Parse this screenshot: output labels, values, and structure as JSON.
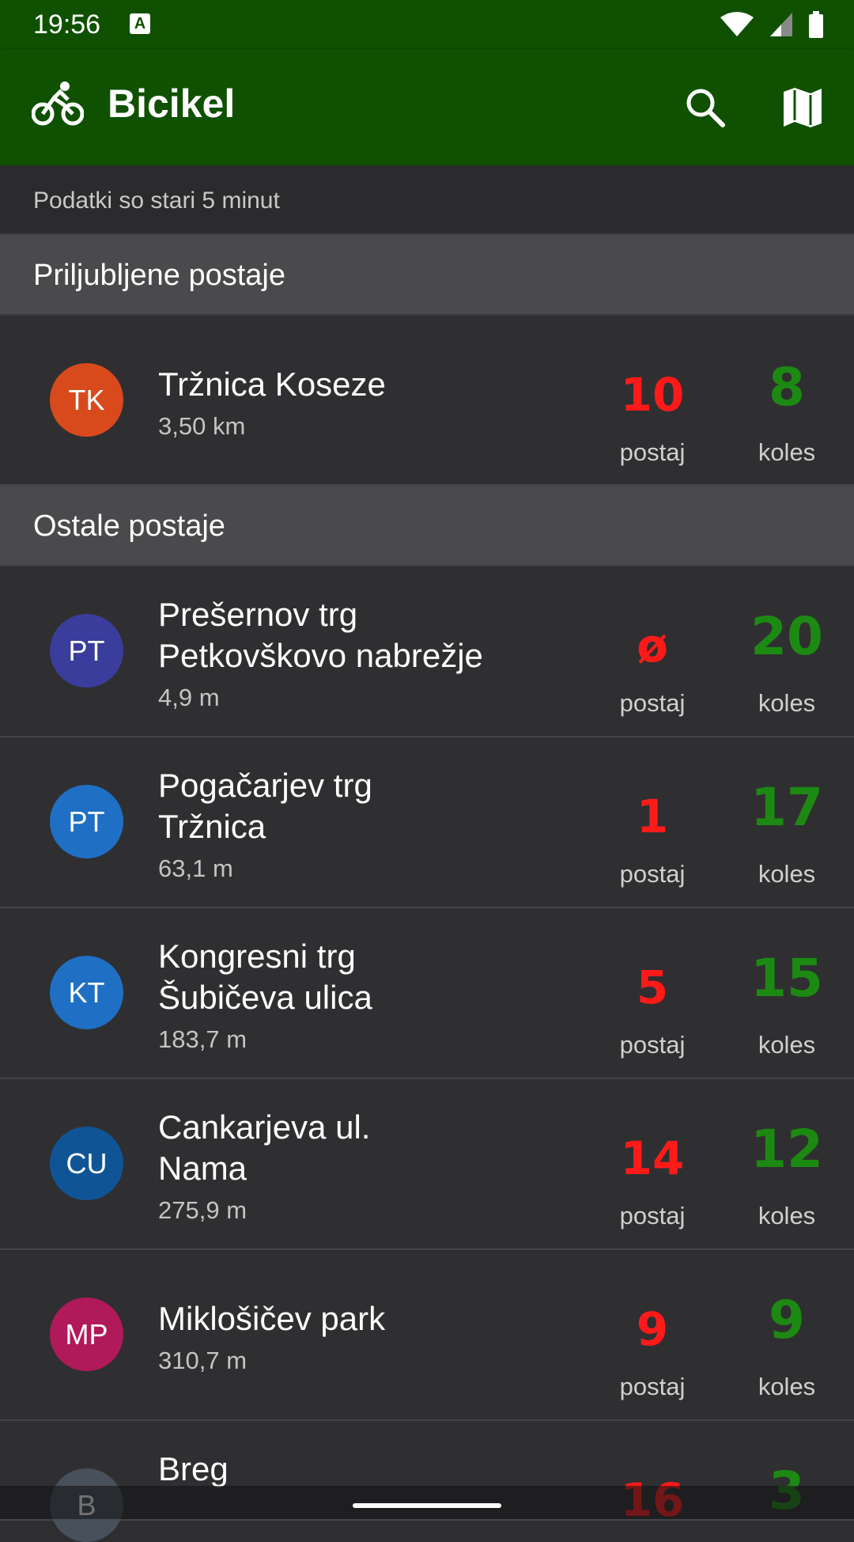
{
  "status": {
    "time": "19:56",
    "notif_letter": "A"
  },
  "app": {
    "title": "Bicikel",
    "icon": "bike-icon",
    "actions": [
      "search-icon",
      "map-icon"
    ]
  },
  "info": "Podatki so stari 5 minut",
  "favorites": {
    "title": "Priljubljene postaje",
    "items": [
      {
        "initials": "TK",
        "color": "#d84a1c",
        "name1": "Tržnica Koseze",
        "name2": "",
        "dist": "3,50 km",
        "stations": "10",
        "bikes": "8"
      }
    ]
  },
  "others": {
    "title": "Ostale postaje",
    "items": [
      {
        "initials": "PT",
        "color": "#3a3d9b",
        "name1": "Prešernov trg",
        "name2": "Petkovškovo nabrežje",
        "dist": "4,9 m",
        "stations": "ø",
        "bikes": "20"
      },
      {
        "initials": "PT",
        "color": "#1f6fc4",
        "name1": "Pogačarjev trg",
        "name2": "Tržnica",
        "dist": "63,1 m",
        "stations": "1",
        "bikes": "17"
      },
      {
        "initials": "KT",
        "color": "#1f6fc4",
        "name1": "Kongresni trg",
        "name2": "Šubičeva ulica",
        "dist": "183,7 m",
        "stations": "5",
        "bikes": "15"
      },
      {
        "initials": "CU",
        "color": "#0f5596",
        "name1": "Cankarjeva ul.",
        "name2": "Nama",
        "dist": "275,9 m",
        "stations": "14",
        "bikes": "12"
      },
      {
        "initials": "MP",
        "color": "#b0195a",
        "name1": "Miklošičev park",
        "name2": "",
        "dist": "310,7 m",
        "stations": "9",
        "bikes": "9"
      },
      {
        "initials": "B",
        "color": "#47505b",
        "name1": "Breg",
        "name2": "",
        "dist": "",
        "stations": "16",
        "bikes": "3"
      }
    ]
  },
  "units": {
    "stations": "postaj",
    "bikes": "koles"
  },
  "colors": {
    "appbar": "#0f5100",
    "stations_count": "#ff1a1a",
    "bikes_count": "#1c8a12"
  }
}
